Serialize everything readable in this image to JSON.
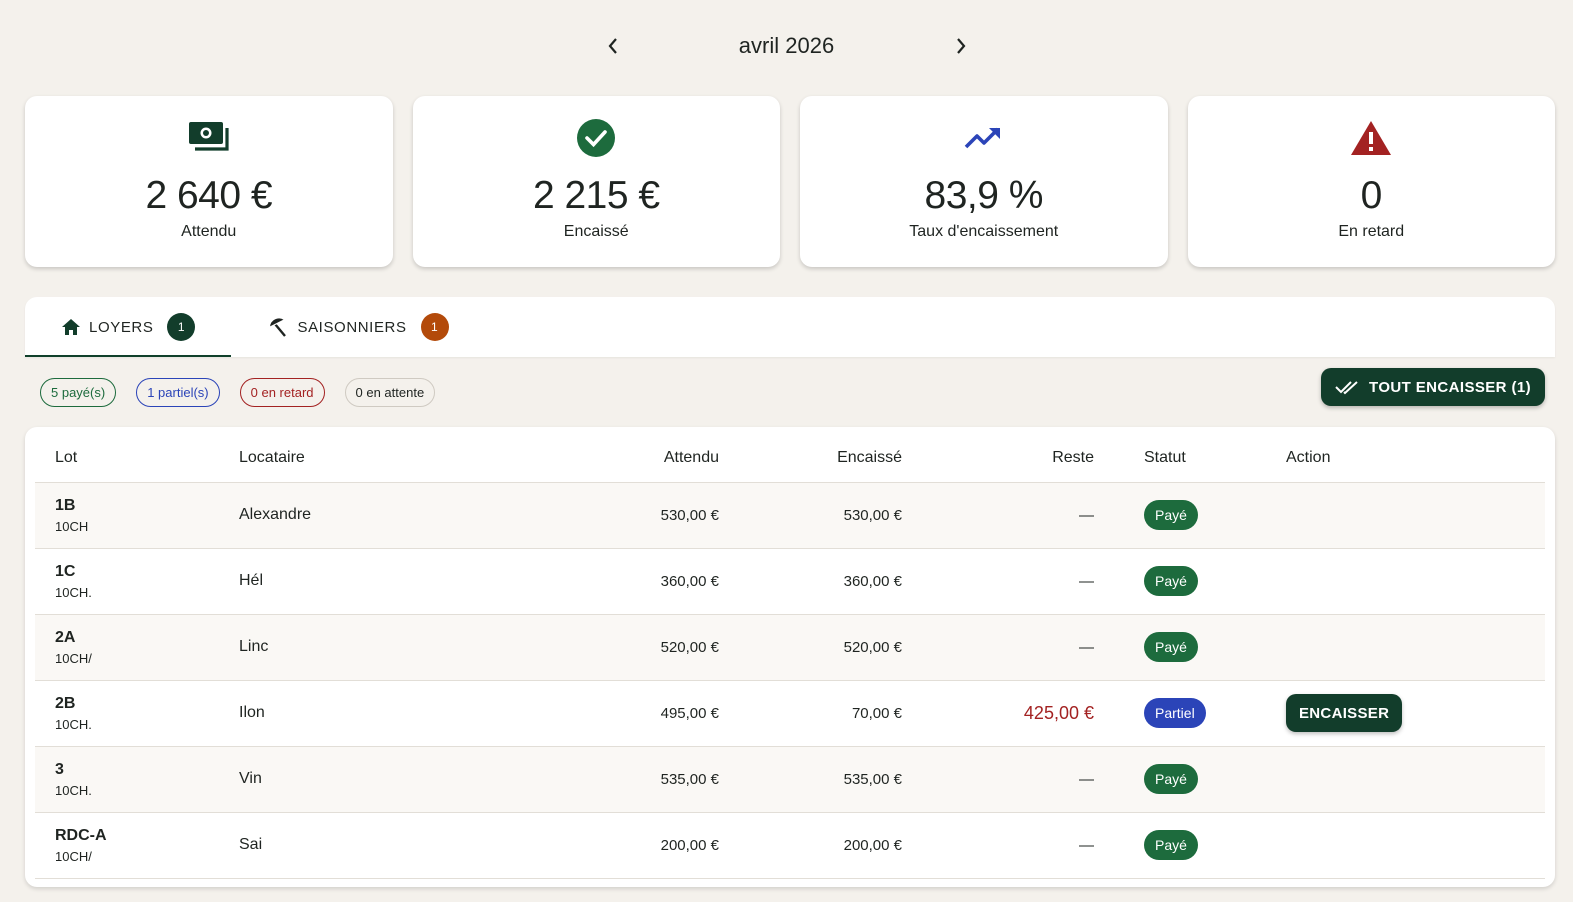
{
  "month": {
    "label": "avril 2026"
  },
  "kpis": [
    {
      "icon": "banknote-icon",
      "value": "2 640 €",
      "label": "Attendu",
      "color": "#123d2b"
    },
    {
      "icon": "check-circle-icon",
      "value": "2 215 €",
      "label": "Encaissé",
      "color": "#1d6b3d"
    },
    {
      "icon": "trending-up-icon",
      "value": "83,9 %",
      "label": "Taux d'encaissement",
      "color": "#2b44b8"
    },
    {
      "icon": "warning-icon",
      "value": "0",
      "label": "En retard",
      "color": "#a32222"
    }
  ],
  "tabs": [
    {
      "label": "LOYERS",
      "count": "1",
      "icon": "home-icon",
      "count_color": "#123d2b"
    },
    {
      "label": "SAISONNIERS",
      "count": "1",
      "icon": "beach-umbrella-icon",
      "count_color": "#b34a0a"
    }
  ],
  "filters": {
    "paid": "5 payé(s)",
    "partial": "1 partiel(s)",
    "late": "0 en retard",
    "waiting": "0 en attente"
  },
  "collect_all_label": "TOUT ENCAISSER (1)",
  "table": {
    "headers": {
      "lot": "Lot",
      "tenant": "Locataire",
      "expected": "Attendu",
      "received": "Encaissé",
      "rest": "Reste",
      "status": "Statut",
      "action": "Action"
    },
    "rows": [
      {
        "lot": "1B",
        "lot_sub": "10CH",
        "tenant": "Alexandre",
        "expected": "530,00 €",
        "received": "530,00 €",
        "rest": "—",
        "status": "Payé",
        "status_type": "paid",
        "action": ""
      },
      {
        "lot": "1C",
        "lot_sub": "10CH.",
        "tenant": "Hél",
        "expected": "360,00 €",
        "received": "360,00 €",
        "rest": "—",
        "status": "Payé",
        "status_type": "paid",
        "action": ""
      },
      {
        "lot": "2A",
        "lot_sub": "10CH/",
        "tenant": "Linc",
        "expected": "520,00 €",
        "received": "520,00 €",
        "rest": "—",
        "status": "Payé",
        "status_type": "paid",
        "action": ""
      },
      {
        "lot": "2B",
        "lot_sub": "10CH.",
        "tenant": "Ilon",
        "expected": "495,00 €",
        "received": "70,00 €",
        "rest": "425,00 €",
        "status": "Partiel",
        "status_type": "partial",
        "action": "ENCAISSER"
      },
      {
        "lot": "3",
        "lot_sub": "10CH.",
        "tenant": "Vin",
        "expected": "535,00 €",
        "received": "535,00 €",
        "rest": "—",
        "status": "Payé",
        "status_type": "paid",
        "action": ""
      },
      {
        "lot": "RDC-A",
        "lot_sub": "10CH/",
        "tenant": "Sai",
        "expected": "200,00 €",
        "received": "200,00 €",
        "rest": "—",
        "status": "Payé",
        "status_type": "paid",
        "action": ""
      }
    ]
  }
}
